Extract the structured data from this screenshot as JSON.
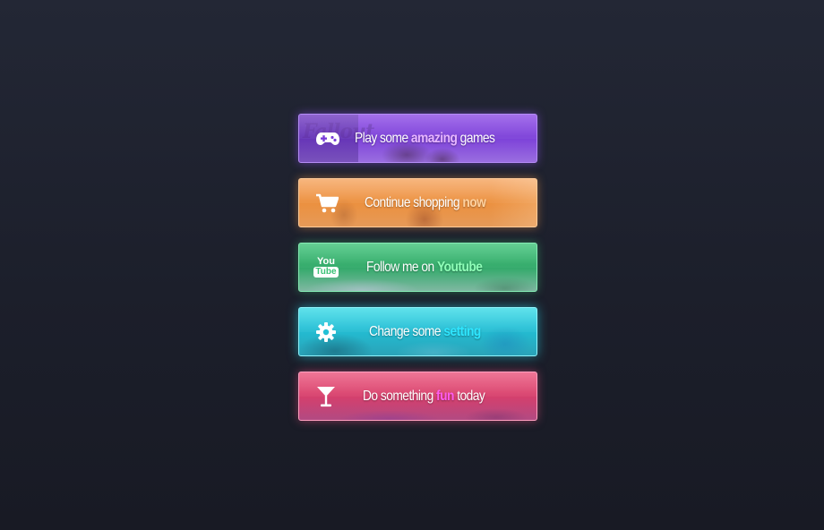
{
  "buttons": [
    {
      "id": "play",
      "icon": "gamepad-icon",
      "prefix": "Play some",
      "highlight": "amazing",
      "suffix": "games",
      "decoration_text": "Fallout",
      "highlight_color": "#e7b6ff",
      "accent": "#8a47e6"
    },
    {
      "id": "shop",
      "icon": "shopping-cart-icon",
      "prefix": "Continue shopping",
      "highlight": "now",
      "suffix": "",
      "highlight_color": "#ffd2a0",
      "accent": "#f5a15a"
    },
    {
      "id": "youtube",
      "icon": "youtube-icon",
      "icon_text_top": "You",
      "icon_text_bottom": "Tube",
      "prefix": "Follow me on",
      "highlight": "Youtube",
      "suffix": "",
      "highlight_color": "#8fffb8",
      "accent": "#3ac276"
    },
    {
      "id": "settings",
      "icon": "gear-icon",
      "prefix": "Change some",
      "highlight": "setting",
      "suffix": "",
      "highlight_color": "#2fe6ff",
      "accent": "#33d9e6"
    },
    {
      "id": "fun",
      "icon": "cocktail-icon",
      "prefix": "Do something",
      "highlight": "fun",
      "suffix": "today",
      "highlight_color": "#ff5cf0",
      "accent": "#ea4f78"
    }
  ]
}
